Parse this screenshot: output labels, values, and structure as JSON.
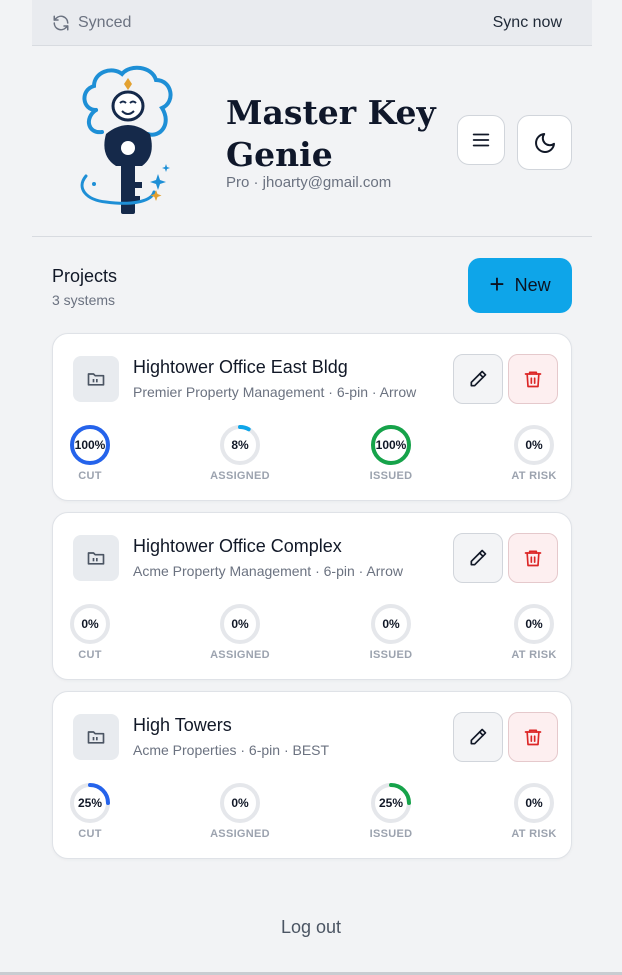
{
  "sync": {
    "status": "Synced",
    "action": "Sync now",
    "icon": "refresh-icon"
  },
  "app": {
    "title": "Master Key Genie",
    "subtitle": "Pro · jhoarty@gmail.com",
    "logo": "genie-key-logo",
    "menu_icon": "hamburger-menu-icon",
    "theme_icon": "moon-icon"
  },
  "projects": {
    "title": "Projects",
    "count": "3 systems",
    "new_label": "New",
    "new_icon": "plus-icon",
    "items": [
      {
        "name": "Hightower Office East Bldg",
        "details": "Premier Property Management · 6-pin · Arrow",
        "stats": [
          {
            "label": "CUT",
            "value": 100,
            "text": "100%",
            "color": "#2563eb"
          },
          {
            "label": "ASSIGNED",
            "value": 8,
            "text": "8%",
            "color": "#0ea5e9"
          },
          {
            "label": "ISSUED",
            "value": 100,
            "text": "100%",
            "color": "#16a34a"
          },
          {
            "label": "AT RISK",
            "value": 0,
            "text": "0%",
            "color": "#ef4444"
          }
        ]
      },
      {
        "name": "Hightower Office Complex",
        "details": "Acme Property Management · 6-pin · Arrow",
        "stats": [
          {
            "label": "CUT",
            "value": 0,
            "text": "0%",
            "color": "#2563eb"
          },
          {
            "label": "ASSIGNED",
            "value": 0,
            "text": "0%",
            "color": "#0ea5e9"
          },
          {
            "label": "ISSUED",
            "value": 0,
            "text": "0%",
            "color": "#16a34a"
          },
          {
            "label": "AT RISK",
            "value": 0,
            "text": "0%",
            "color": "#ef4444"
          }
        ]
      },
      {
        "name": "High Towers",
        "details": "Acme Properties · 6-pin · BEST",
        "stats": [
          {
            "label": "CUT",
            "value": 25,
            "text": "25%",
            "color": "#2563eb"
          },
          {
            "label": "ASSIGNED",
            "value": 0,
            "text": "0%",
            "color": "#0ea5e9"
          },
          {
            "label": "ISSUED",
            "value": 25,
            "text": "25%",
            "color": "#16a34a"
          },
          {
            "label": "AT RISK",
            "value": 0,
            "text": "0%",
            "color": "#ef4444"
          }
        ]
      }
    ]
  },
  "footer": {
    "logout": "Log out"
  },
  "colors": {
    "accent": "#0ea5e9",
    "danger": "#dc2626",
    "track": "#e5e7eb"
  }
}
